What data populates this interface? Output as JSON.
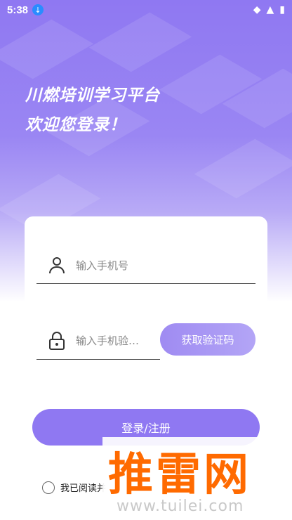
{
  "status_bar": {
    "time": "5:38",
    "download_symbol": "↓",
    "icons": [
      "network-icon",
      "wifi-icon",
      "battery-icon"
    ]
  },
  "hero": {
    "title_line1": "川燃培训学习平台",
    "title_line2": "欢迎您登录！"
  },
  "form": {
    "phone_placeholder": "输入手机号",
    "code_placeholder": "输入手机验…",
    "get_code_label": "获取验证码",
    "login_label": "登录/注册",
    "agree_text": "我已阅读并"
  },
  "watermark": {
    "main": "推雷网",
    "url": "www.tuilei.com"
  },
  "colors": {
    "accent": "#8f78f2",
    "accent_light": "#b3a5f6",
    "watermark": "#ff6a00"
  }
}
